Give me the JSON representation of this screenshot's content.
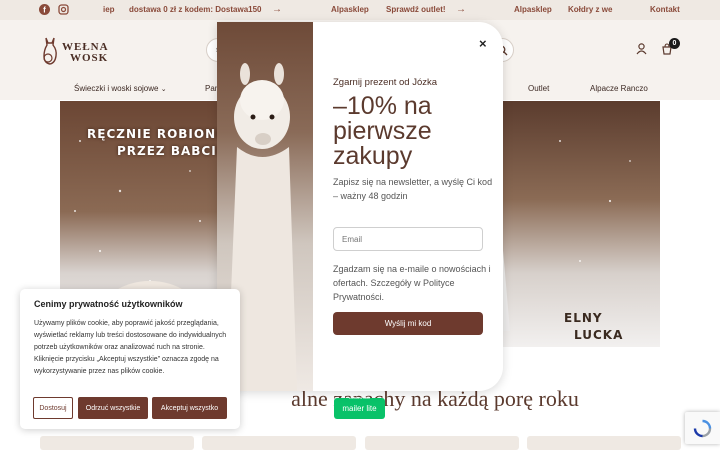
{
  "topbar": {
    "promo_left_fragment": "iep",
    "promo_main": "dostawa 0 zł z kodem: Dostawa150",
    "link_alpasklep_1": "Alpasklep",
    "link_outlet": "Sprawdź outlet!",
    "link_alpasklep_2": "Alpasklep",
    "link_koldry": "Kołdry z we",
    "link_kontakt": "Kontakt"
  },
  "header": {
    "logo_line1": "WEŁNA",
    "logo_line2": "WOSK",
    "search_fragment": "s",
    "cart_count": "0"
  },
  "nav": {
    "item1": "Świeczki i woski sojowe",
    "item2_fragment": "Pam",
    "item3": "Outlet",
    "item4": "Alpacze Ranczo"
  },
  "hero": {
    "left_line1": "RĘCZNIE ROBIONE",
    "left_line2": "PRZEZ BABCIĘ",
    "right_line1": "ELNY",
    "right_line2": "LUCKA"
  },
  "section_title_fragment": "alne zapachy na każdą porę roku",
  "modal": {
    "eyebrow": "Zgarnij prezent od Józka",
    "title": "–10% na pierwsze zakupy",
    "description": "Zapisz się na newsletter, a wyślę Ci kod – ważny 48 godzin",
    "email_placeholder": "Email",
    "consent": "Zgadzam się na e-maile o nowościach i ofertach. Szczegóły w Polityce Prywatności.",
    "submit_label": "Wyślij mi kod",
    "close_symbol": "×"
  },
  "mailer_badge": {
    "line1": "created with",
    "line2": "mailer lite"
  },
  "cookie": {
    "title": "Cenimy prywatność użytkowników",
    "text": "Używamy plików cookie, aby poprawić jakość przeglądania, wyświetlać reklamy lub treści dostosowane do indywidualnych potrzeb użytkowników oraz analizować ruch na stronie. Kliknięcie przycisku „Akceptuj wszystkie” oznacza zgodę na wykorzystywanie przez nas plików cookie.",
    "btn_custom": "Dostosuj",
    "btn_reject": "Odrzuć wszystkie",
    "btn_accept": "Akceptuj wszystko"
  },
  "colors": {
    "accent": "#6e3a2e",
    "topbar_bg": "#efe9e3",
    "mailerlite": "#09c269"
  },
  "icons": [
    "facebook-icon",
    "instagram-icon",
    "arrow-right-icon",
    "search-icon",
    "user-icon",
    "cart-icon",
    "chevron-down-icon",
    "close-icon",
    "recaptcha-icon"
  ]
}
